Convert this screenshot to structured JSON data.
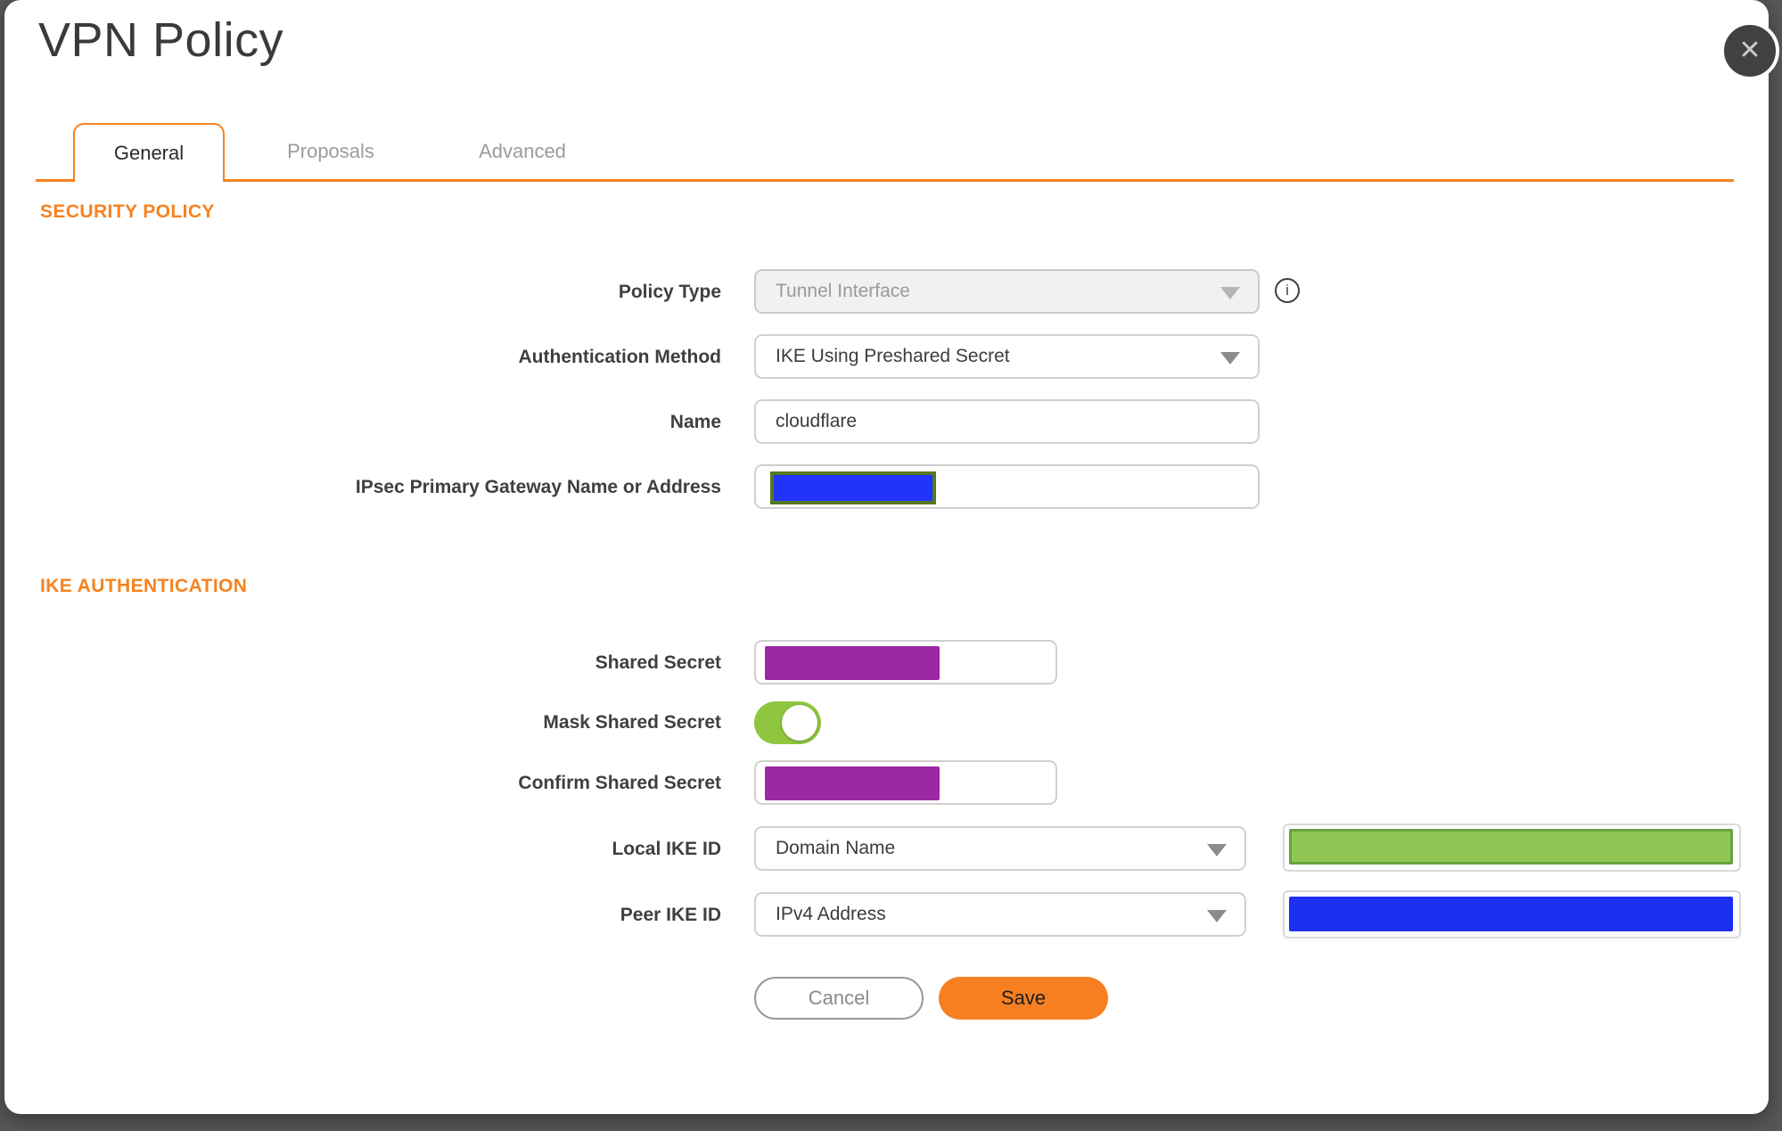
{
  "colors": {
    "accent_orange": "#F6821F",
    "save_orange": "#F77F22",
    "toggle_green": "#8FC63F",
    "redact_purple": "#9C28A4",
    "redact_blue": "#1C2FF2",
    "redact_gateway_blue": "#2233FA",
    "redact_gateway_border": "#55791D",
    "redact_green": "#8FC653",
    "redact_green_border": "#66A23C",
    "backdrop_gray": "#57575A"
  },
  "dialog": {
    "title": "VPN Policy",
    "close_icon": "✕"
  },
  "tabs": [
    {
      "label": "General",
      "active": true
    },
    {
      "label": "Proposals",
      "active": false
    },
    {
      "label": "Advanced",
      "active": false
    }
  ],
  "security_policy": {
    "heading": "SECURITY POLICY",
    "policy_type_label": "Policy Type",
    "policy_type_value": "Tunnel Interface",
    "policy_type_disabled": true,
    "info_icon": "i",
    "auth_method_label": "Authentication Method",
    "auth_method_value": "IKE Using Preshared Secret",
    "name_label": "Name",
    "name_value": "cloudflare",
    "gateway_label": "IPsec Primary Gateway Name or Address",
    "gateway_value_redacted": true
  },
  "ike_authentication": {
    "heading": "IKE AUTHENTICATION",
    "shared_secret_label": "Shared Secret",
    "shared_secret_redacted": true,
    "mask_shared_secret_label": "Mask Shared Secret",
    "mask_shared_secret_on": true,
    "confirm_shared_secret_label": "Confirm Shared Secret",
    "confirm_shared_secret_redacted": true,
    "local_ike_id_label": "Local IKE ID",
    "local_ike_id_type": "Domain Name",
    "local_ike_id_value_redacted": true,
    "peer_ike_id_label": "Peer IKE ID",
    "peer_ike_id_type": "IPv4 Address",
    "peer_ike_id_value_redacted": true
  },
  "footer": {
    "cancel_label": "Cancel",
    "save_label": "Save"
  }
}
